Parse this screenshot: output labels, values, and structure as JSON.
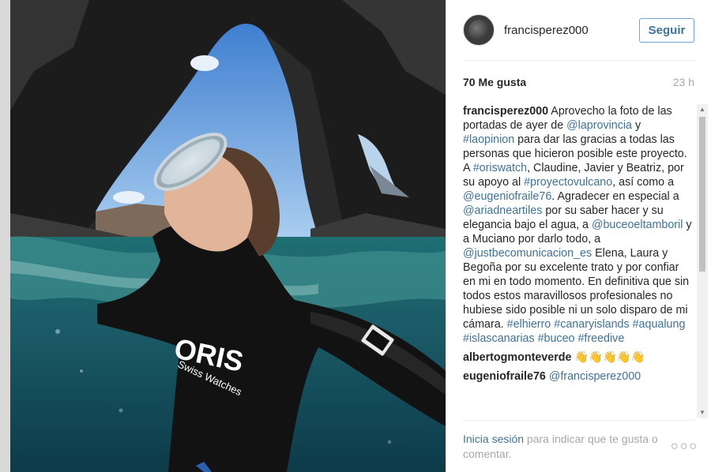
{
  "post": {
    "username": "francisperez000",
    "follow_label": "Seguir",
    "likes": "70 Me gusta",
    "time": "23 h",
    "photo_logo": "ORIS",
    "photo_logo_sub": "Swiss Watches"
  },
  "caption": {
    "user": "francisperez000",
    "t1": " Aprovecho la foto de las portadas de ayer de ",
    "l1": "@laprovincia",
    "t2": " y ",
    "l2": "#laopinion",
    "t3": " para dar las gracias a todas las personas que hicieron posible este proyecto. A ",
    "l3": "#oriswatch",
    "t4": ", Claudine, Javier y Beatriz, por su apoyo al ",
    "l4": "#proyectovulcano",
    "t5": ", así como a ",
    "l5": "@eugeniofraile76",
    "t6": ". Agradecer en especial a ",
    "l6": "@ariadneartiles",
    "t7": " por su saber hacer y su elegancia bajo el agua, a ",
    "l7": "@buceoeltamboril",
    "t8": " y a Muciano por darlo todo, a ",
    "l8": "@justbecomunicacion_es",
    "t9": " Elena, Laura y Begoña por su excelente trato y por confiar en mi en todo momento. En definitiva que sin todos estos maravillosos profesionales no hubiese sido posible ni un solo disparo de mi cámara. ",
    "l9": "#elhierro",
    "t10": " ",
    "l10": "#canaryislands",
    "t11": " ",
    "l11": "#aqualung",
    "t12": " ",
    "l12": "#islascanarias",
    "t13": " ",
    "l13": "#buceo",
    "t14": " ",
    "l14": "#freedive"
  },
  "comments": [
    {
      "user": "albertogmonteverde",
      "text": " 👋👋👋👋👋"
    },
    {
      "user": "eugeniofraile76",
      "text": " @francisperez000"
    }
  ],
  "footer": {
    "login_link": "Inicia sesión",
    "login_text": " para indicar que te gusta o comentar.",
    "more": "○○○"
  },
  "icons": {
    "scroll_up": "▲",
    "scroll_down": "▼"
  },
  "colors": {
    "link": "#3f729b",
    "follow_border": "#70a3d8",
    "muted": "#a5a7aa"
  }
}
